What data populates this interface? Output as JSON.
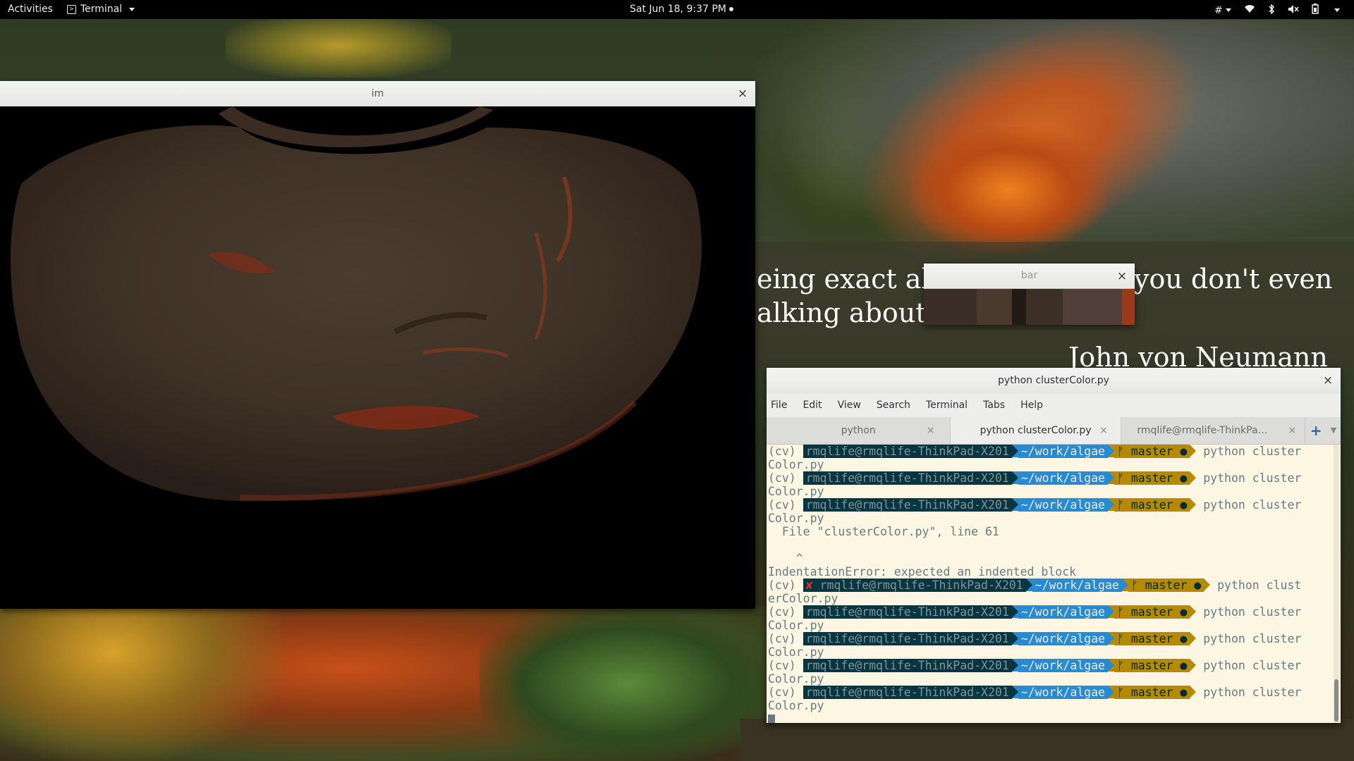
{
  "topbar": {
    "activities": "Activities",
    "app_menu": "Terminal",
    "clock": "Sat Jun 18,  9:37 PM",
    "keyboard_indicator": "#"
  },
  "desktop": {
    "quote_line1_left": "eing exact abo",
    "quote_line1_right": "you don't even",
    "quote_line2": "alking about.’",
    "attribution": "John von Neumann"
  },
  "windows": {
    "im": {
      "title": "im",
      "close": "×"
    },
    "bar": {
      "title": "bar",
      "close": "×",
      "swatches": [
        "#3a2e26",
        "#4a3a2e",
        "#221a14",
        "#3b2f26",
        "#51403a",
        "#9a3a1a"
      ]
    },
    "terminal": {
      "title": "python clusterColor.py",
      "close": "×",
      "menu": [
        "File",
        "Edit",
        "View",
        "Search",
        "Terminal",
        "Tabs",
        "Help"
      ],
      "tabs": [
        {
          "label": "python",
          "close": "×"
        },
        {
          "label": "python clusterColor.py",
          "close": "×"
        },
        {
          "label": "rmqlife@rmqlife-ThinkPa…",
          "close": "×"
        }
      ],
      "tab_add": "+",
      "prompt": {
        "env": "(cv)",
        "host": "rmqlife@rmqlife-ThinkPad-X201",
        "path": "~/work/algae",
        "branch": "ᚠ master ●",
        "cmd": "python cluster",
        "wrap": "Color.py",
        "err_cmd": "python clust",
        "err_wrap": "erColor.py",
        "err_mark": "✘"
      },
      "error": {
        "file_line": "  File \"clusterColor.py\", line 61",
        "caret_line": "    ^",
        "message": "IndentationError: expected an indented block"
      }
    }
  }
}
